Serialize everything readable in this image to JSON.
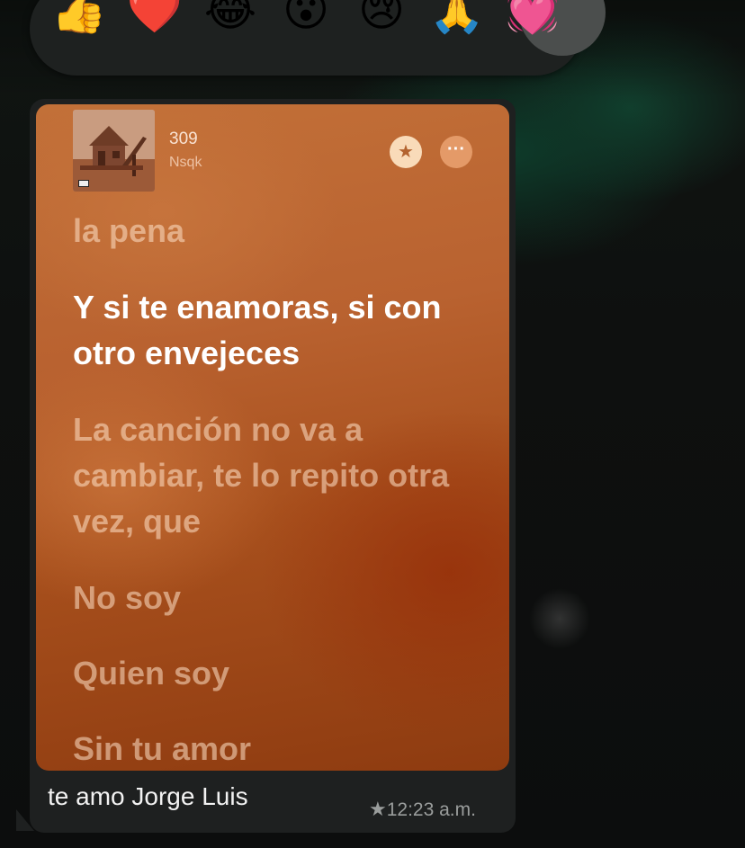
{
  "reactions": {
    "items": [
      {
        "name": "thumbs-up-icon",
        "glyph": "👍"
      },
      {
        "name": "red-heart-icon",
        "glyph": "❤️"
      },
      {
        "name": "tears-of-joy-icon",
        "glyph": "😂"
      },
      {
        "name": "surprised-face-icon",
        "glyph": "😮"
      },
      {
        "name": "crying-face-icon",
        "glyph": "😢"
      },
      {
        "name": "folded-hands-icon",
        "glyph": "🙏"
      },
      {
        "name": "growing-heart-icon",
        "glyph": "💓"
      }
    ],
    "selected": "growing-heart-icon"
  },
  "song": {
    "title": "309",
    "artist": "Nsqk"
  },
  "lyrics": {
    "previous_partial": "la pena",
    "active": "Y si te enamoras, si con otro envejeces",
    "next_1": "La canción no va a cambiar, te lo repito otra vez, que",
    "next_2": "No soy",
    "next_3": "Quien soy",
    "next_4": "Sin tu amor"
  },
  "message": {
    "caption": "te amo Jorge Luis",
    "starred_glyph": "★",
    "time": "12:23 a.m."
  },
  "colors": {
    "bubble": "#1e2020",
    "card_top": "#c27038",
    "card_bottom": "#8e3b10",
    "timestamp": "#9a9d9c"
  }
}
